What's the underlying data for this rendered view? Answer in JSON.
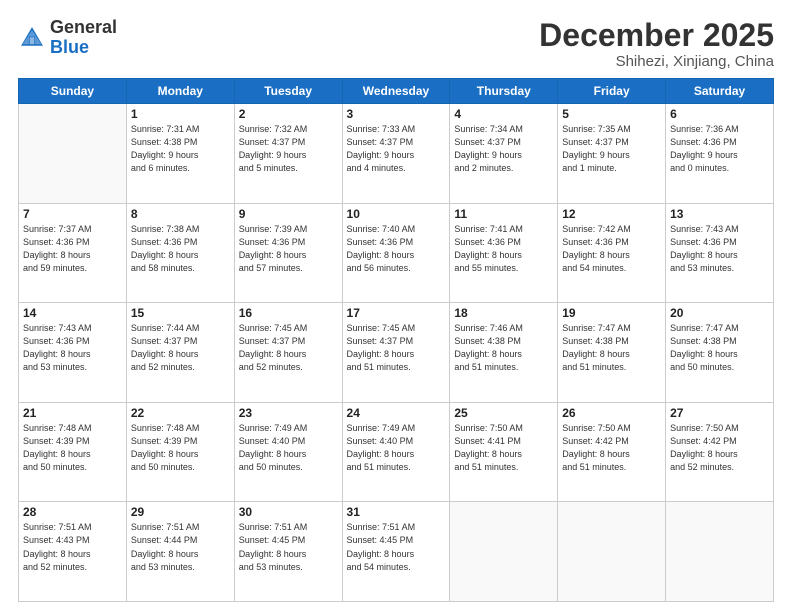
{
  "logo": {
    "line1": "General",
    "line2": "Blue"
  },
  "header": {
    "month": "December 2025",
    "location": "Shihezi, Xinjiang, China"
  },
  "weekdays": [
    "Sunday",
    "Monday",
    "Tuesday",
    "Wednesday",
    "Thursday",
    "Friday",
    "Saturday"
  ],
  "weeks": [
    [
      {
        "day": "",
        "info": ""
      },
      {
        "day": "1",
        "info": "Sunrise: 7:31 AM\nSunset: 4:38 PM\nDaylight: 9 hours\nand 6 minutes."
      },
      {
        "day": "2",
        "info": "Sunrise: 7:32 AM\nSunset: 4:37 PM\nDaylight: 9 hours\nand 5 minutes."
      },
      {
        "day": "3",
        "info": "Sunrise: 7:33 AM\nSunset: 4:37 PM\nDaylight: 9 hours\nand 4 minutes."
      },
      {
        "day": "4",
        "info": "Sunrise: 7:34 AM\nSunset: 4:37 PM\nDaylight: 9 hours\nand 2 minutes."
      },
      {
        "day": "5",
        "info": "Sunrise: 7:35 AM\nSunset: 4:37 PM\nDaylight: 9 hours\nand 1 minute."
      },
      {
        "day": "6",
        "info": "Sunrise: 7:36 AM\nSunset: 4:36 PM\nDaylight: 9 hours\nand 0 minutes."
      }
    ],
    [
      {
        "day": "7",
        "info": "Sunrise: 7:37 AM\nSunset: 4:36 PM\nDaylight: 8 hours\nand 59 minutes."
      },
      {
        "day": "8",
        "info": "Sunrise: 7:38 AM\nSunset: 4:36 PM\nDaylight: 8 hours\nand 58 minutes."
      },
      {
        "day": "9",
        "info": "Sunrise: 7:39 AM\nSunset: 4:36 PM\nDaylight: 8 hours\nand 57 minutes."
      },
      {
        "day": "10",
        "info": "Sunrise: 7:40 AM\nSunset: 4:36 PM\nDaylight: 8 hours\nand 56 minutes."
      },
      {
        "day": "11",
        "info": "Sunrise: 7:41 AM\nSunset: 4:36 PM\nDaylight: 8 hours\nand 55 minutes."
      },
      {
        "day": "12",
        "info": "Sunrise: 7:42 AM\nSunset: 4:36 PM\nDaylight: 8 hours\nand 54 minutes."
      },
      {
        "day": "13",
        "info": "Sunrise: 7:43 AM\nSunset: 4:36 PM\nDaylight: 8 hours\nand 53 minutes."
      }
    ],
    [
      {
        "day": "14",
        "info": "Sunrise: 7:43 AM\nSunset: 4:36 PM\nDaylight: 8 hours\nand 53 minutes."
      },
      {
        "day": "15",
        "info": "Sunrise: 7:44 AM\nSunset: 4:37 PM\nDaylight: 8 hours\nand 52 minutes."
      },
      {
        "day": "16",
        "info": "Sunrise: 7:45 AM\nSunset: 4:37 PM\nDaylight: 8 hours\nand 52 minutes."
      },
      {
        "day": "17",
        "info": "Sunrise: 7:45 AM\nSunset: 4:37 PM\nDaylight: 8 hours\nand 51 minutes."
      },
      {
        "day": "18",
        "info": "Sunrise: 7:46 AM\nSunset: 4:38 PM\nDaylight: 8 hours\nand 51 minutes."
      },
      {
        "day": "19",
        "info": "Sunrise: 7:47 AM\nSunset: 4:38 PM\nDaylight: 8 hours\nand 51 minutes."
      },
      {
        "day": "20",
        "info": "Sunrise: 7:47 AM\nSunset: 4:38 PM\nDaylight: 8 hours\nand 50 minutes."
      }
    ],
    [
      {
        "day": "21",
        "info": "Sunrise: 7:48 AM\nSunset: 4:39 PM\nDaylight: 8 hours\nand 50 minutes."
      },
      {
        "day": "22",
        "info": "Sunrise: 7:48 AM\nSunset: 4:39 PM\nDaylight: 8 hours\nand 50 minutes."
      },
      {
        "day": "23",
        "info": "Sunrise: 7:49 AM\nSunset: 4:40 PM\nDaylight: 8 hours\nand 50 minutes."
      },
      {
        "day": "24",
        "info": "Sunrise: 7:49 AM\nSunset: 4:40 PM\nDaylight: 8 hours\nand 51 minutes."
      },
      {
        "day": "25",
        "info": "Sunrise: 7:50 AM\nSunset: 4:41 PM\nDaylight: 8 hours\nand 51 minutes."
      },
      {
        "day": "26",
        "info": "Sunrise: 7:50 AM\nSunset: 4:42 PM\nDaylight: 8 hours\nand 51 minutes."
      },
      {
        "day": "27",
        "info": "Sunrise: 7:50 AM\nSunset: 4:42 PM\nDaylight: 8 hours\nand 52 minutes."
      }
    ],
    [
      {
        "day": "28",
        "info": "Sunrise: 7:51 AM\nSunset: 4:43 PM\nDaylight: 8 hours\nand 52 minutes."
      },
      {
        "day": "29",
        "info": "Sunrise: 7:51 AM\nSunset: 4:44 PM\nDaylight: 8 hours\nand 53 minutes."
      },
      {
        "day": "30",
        "info": "Sunrise: 7:51 AM\nSunset: 4:45 PM\nDaylight: 8 hours\nand 53 minutes."
      },
      {
        "day": "31",
        "info": "Sunrise: 7:51 AM\nSunset: 4:45 PM\nDaylight: 8 hours\nand 54 minutes."
      },
      {
        "day": "",
        "info": ""
      },
      {
        "day": "",
        "info": ""
      },
      {
        "day": "",
        "info": ""
      }
    ]
  ]
}
